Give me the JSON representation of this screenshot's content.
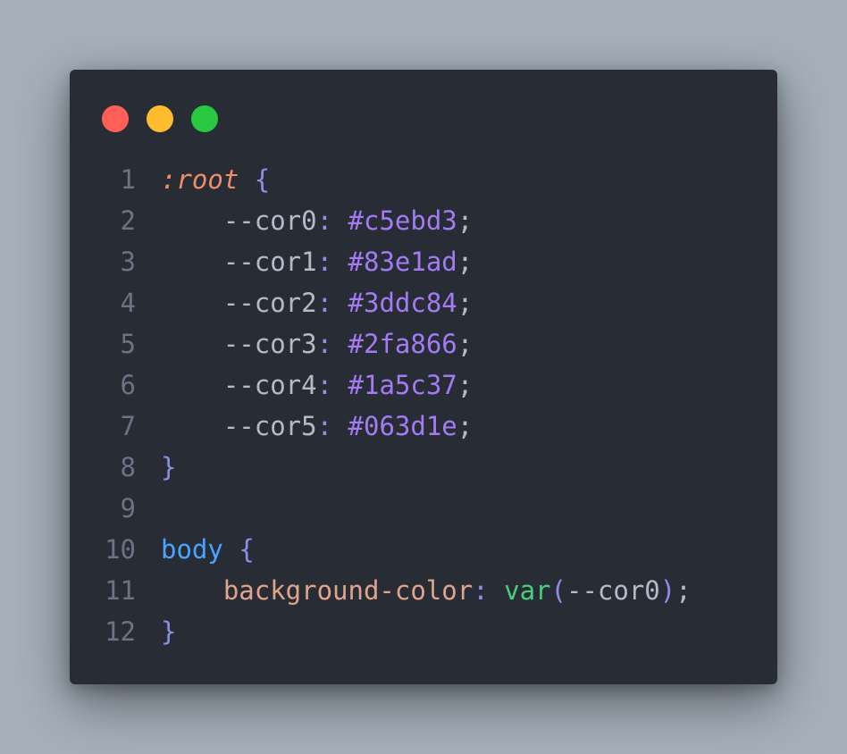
{
  "colors": {
    "page_background": "#a5b0bb",
    "window_background": "#282c35",
    "dot_red": "#ff5f57",
    "dot_yellow": "#febc2e",
    "dot_green": "#28c840",
    "line_number": "#6c7385",
    "selector_pseudo": "#f08d6a",
    "selector_tag": "#4aa3ff",
    "brace": "#8c8fe8",
    "property_variable": "#b4bac8",
    "punctuation": "#8c8fe8",
    "value_hex": "#a37bf2",
    "property_name": "#e0a38c",
    "function_name": "#46d07a"
  },
  "window_controls": [
    "close",
    "minimize",
    "maximize"
  ],
  "code": {
    "line_numbers": [
      "1",
      "2",
      "3",
      "4",
      "5",
      "6",
      "7",
      "8",
      "9",
      "10",
      "11",
      "12"
    ],
    "lines": [
      [
        {
          "t": ":root",
          "c": "selector_pseudo",
          "italic": true
        },
        {
          "t": " ",
          "c": "property_variable"
        },
        {
          "t": "{",
          "c": "brace"
        }
      ],
      [
        {
          "t": "    --cor0",
          "c": "property_variable"
        },
        {
          "t": ": ",
          "c": "punctuation"
        },
        {
          "t": "#c5ebd3",
          "c": "value_hex"
        },
        {
          "t": ";",
          "c": "property_variable"
        }
      ],
      [
        {
          "t": "    --cor1",
          "c": "property_variable"
        },
        {
          "t": ": ",
          "c": "punctuation"
        },
        {
          "t": "#83e1ad",
          "c": "value_hex"
        },
        {
          "t": ";",
          "c": "property_variable"
        }
      ],
      [
        {
          "t": "    --cor2",
          "c": "property_variable"
        },
        {
          "t": ": ",
          "c": "punctuation"
        },
        {
          "t": "#3ddc84",
          "c": "value_hex"
        },
        {
          "t": ";",
          "c": "property_variable"
        }
      ],
      [
        {
          "t": "    --cor3",
          "c": "property_variable"
        },
        {
          "t": ": ",
          "c": "punctuation"
        },
        {
          "t": "#2fa866",
          "c": "value_hex"
        },
        {
          "t": ";",
          "c": "property_variable"
        }
      ],
      [
        {
          "t": "    --cor4",
          "c": "property_variable"
        },
        {
          "t": ": ",
          "c": "punctuation"
        },
        {
          "t": "#1a5c37",
          "c": "value_hex"
        },
        {
          "t": ";",
          "c": "property_variable"
        }
      ],
      [
        {
          "t": "    --cor5",
          "c": "property_variable"
        },
        {
          "t": ": ",
          "c": "punctuation"
        },
        {
          "t": "#063d1e",
          "c": "value_hex"
        },
        {
          "t": ";",
          "c": "property_variable"
        }
      ],
      [
        {
          "t": "}",
          "c": "brace"
        }
      ],
      [],
      [
        {
          "t": "body",
          "c": "selector_tag"
        },
        {
          "t": " ",
          "c": "property_variable"
        },
        {
          "t": "{",
          "c": "brace"
        }
      ],
      [
        {
          "t": "    background-color",
          "c": "property_name"
        },
        {
          "t": ": ",
          "c": "punctuation"
        },
        {
          "t": "var",
          "c": "function_name"
        },
        {
          "t": "(",
          "c": "brace"
        },
        {
          "t": "--cor0",
          "c": "property_variable"
        },
        {
          "t": ")",
          "c": "brace"
        },
        {
          "t": ";",
          "c": "property_variable"
        }
      ],
      [
        {
          "t": "}",
          "c": "brace"
        }
      ]
    ]
  }
}
